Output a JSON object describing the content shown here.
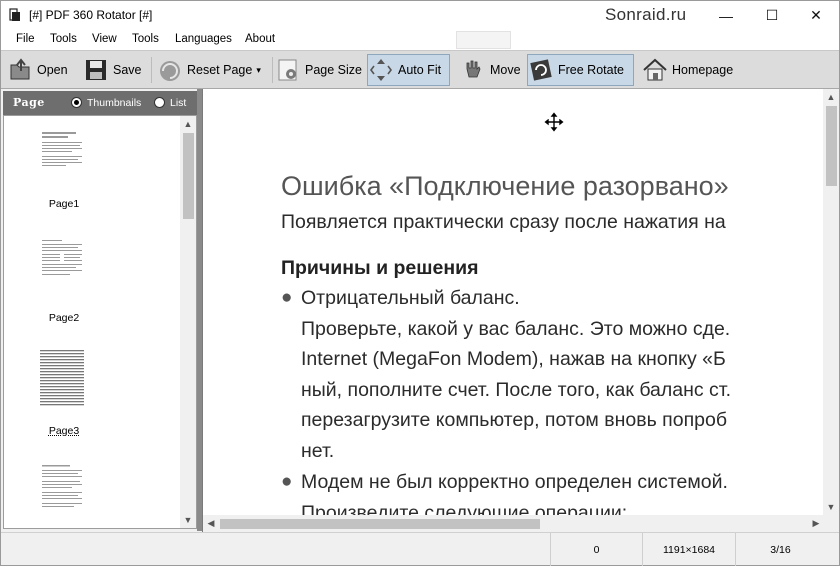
{
  "window": {
    "title": "[#] PDF 360 Rotator [#]",
    "watermark": "Sonraid.ru",
    "controls": {
      "minimize": "—",
      "maximize": "☐",
      "close": "✕"
    }
  },
  "menu": [
    "File",
    "Tools",
    "View",
    "Tools",
    "Languages",
    "About"
  ],
  "toolbar": {
    "open": "Open",
    "save": "Save",
    "reset_page": "Reset Page",
    "reset_page_caret": "▾",
    "page_size": "Page Size",
    "auto_fit": "Auto Fit",
    "move": "Move",
    "free_rotate": "Free Rotate",
    "homepage": "Homepage"
  },
  "left_panel": {
    "title": "Page",
    "view_options": [
      {
        "label": "Thumbnails",
        "selected": true
      },
      {
        "label": "List",
        "selected": false
      }
    ],
    "pages": [
      {
        "label": "Page1"
      },
      {
        "label": "Page2"
      },
      {
        "label": "Page3",
        "selected": true
      },
      {
        "label": ""
      }
    ]
  },
  "document": {
    "heading": "Ошибка «Подключение разорвано»",
    "intro": "Появляется практически сразу после нажатия на",
    "subheading": "Причины и решения",
    "bullet1": {
      "title": "Отрицательный баланс.",
      "lines": [
        "Проверьте, какой у вас баланс. Это можно сде.",
        "Internet (MegaFon Modem), нажав на кнопку «Б",
        "ный, пополните счет. После того, как баланс ст.",
        "перезагрузите компьютер, потом вновь попроб",
        "нет."
      ]
    },
    "bullet2": {
      "title": "Модем не был корректно определен системой.",
      "line": "Произведите следующие операции:"
    }
  },
  "statusbar": {
    "rotation": "0",
    "page_size": "1191×1684",
    "page_index": "3/16"
  }
}
